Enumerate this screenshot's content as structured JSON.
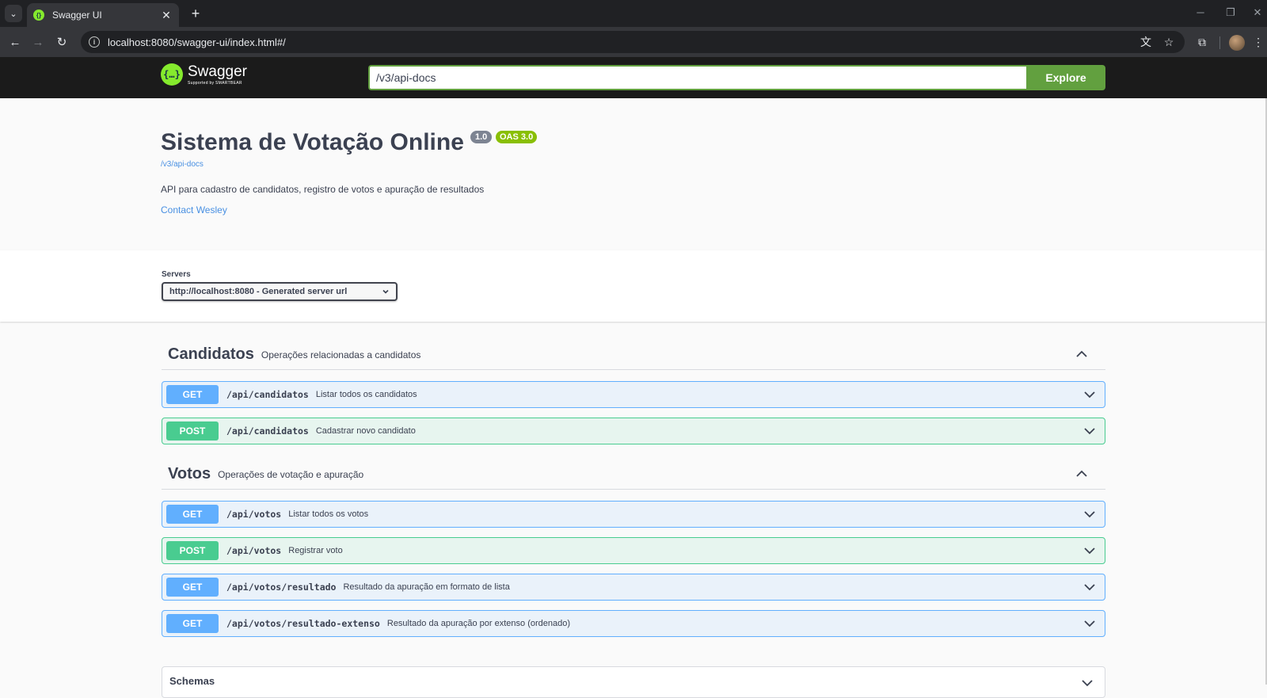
{
  "browser": {
    "tab_title": "Swagger UI",
    "tab_close": "✕",
    "new_tab": "+",
    "url": "localhost:8080/swagger-ui/index.html#/"
  },
  "topbar": {
    "logo_word": "Swagger",
    "logo_sub": "Supported by SMARTBEAR",
    "logo_glyph": "{…}",
    "spec_url": "/v3/api-docs",
    "explore_label": "Explore"
  },
  "info": {
    "title": "Sistema de Votação Online",
    "version": "1.0",
    "oas": "OAS 3.0",
    "spec_link": "/v3/api-docs",
    "description": "API para cadastro de candidatos, registro de votos e apuração de resultados",
    "contact": "Contact Wesley"
  },
  "servers": {
    "label": "Servers",
    "selected": "http://localhost:8080 - Generated server url"
  },
  "tags": [
    {
      "name": "Candidatos",
      "description": "Operações relacionadas a candidatos",
      "operations": [
        {
          "method": "GET",
          "path": "/api/candidatos",
          "summary": "Listar todos os candidatos"
        },
        {
          "method": "POST",
          "path": "/api/candidatos",
          "summary": "Cadastrar novo candidato"
        }
      ]
    },
    {
      "name": "Votos",
      "description": "Operações de votação e apuração",
      "operations": [
        {
          "method": "GET",
          "path": "/api/votos",
          "summary": "Listar todos os votos"
        },
        {
          "method": "POST",
          "path": "/api/votos",
          "summary": "Registrar voto"
        },
        {
          "method": "GET",
          "path": "/api/votos/resultado",
          "summary": "Resultado da apuração em formato de lista"
        },
        {
          "method": "GET",
          "path": "/api/votos/resultado-extenso",
          "summary": "Resultado da apuração por extenso (ordenado)"
        }
      ]
    }
  ],
  "schemas": {
    "label": "Schemas"
  },
  "colors": {
    "get": "#61affe",
    "post": "#49cc90",
    "explore": "#62a03f",
    "link": "#4990e2",
    "text": "#3b4151"
  }
}
